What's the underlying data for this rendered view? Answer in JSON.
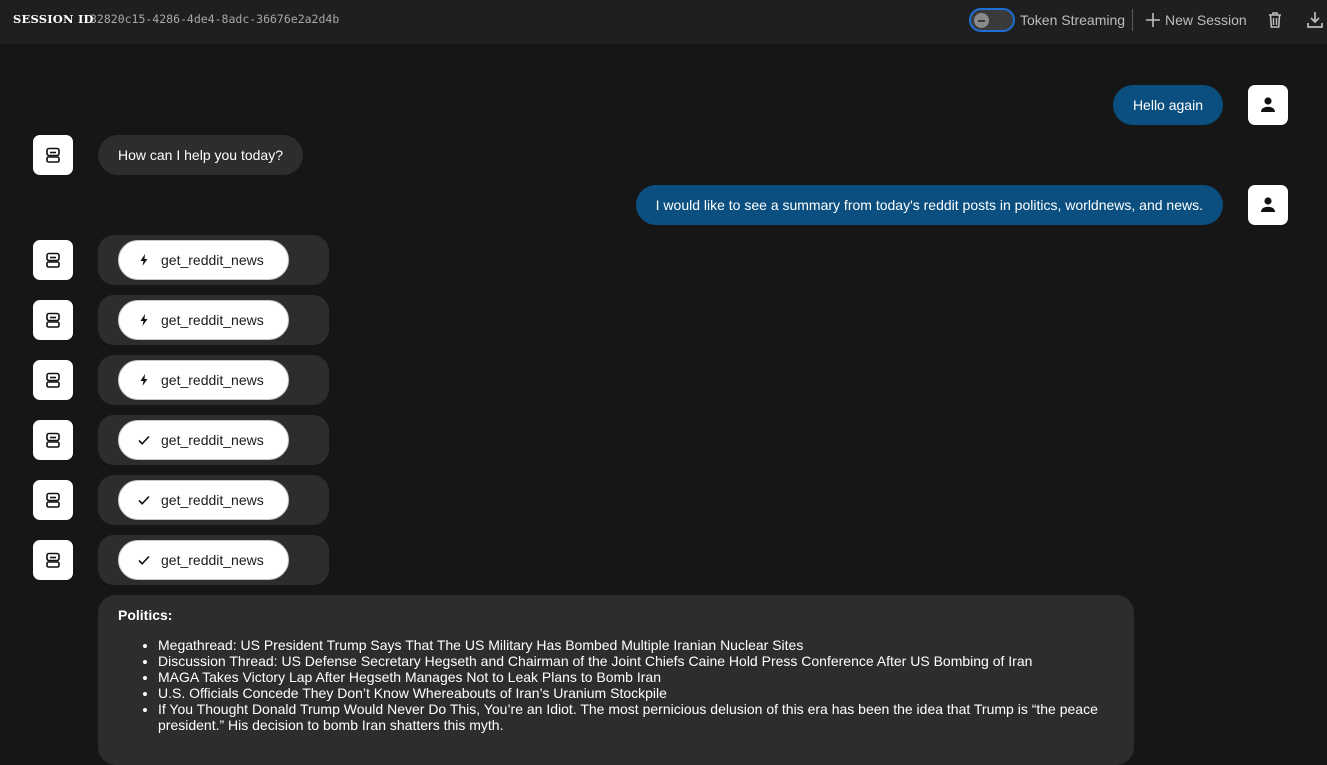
{
  "header": {
    "session_label": "SESSION ID",
    "session_id": "32820c15-4286-4de4-8adc-36676e2a2d4b",
    "token_streaming_label": "Token Streaming",
    "token_streaming_on": false,
    "new_session_label": "New Session",
    "accent_color": "#1f6fd6"
  },
  "messages": [
    {
      "role": "user",
      "text": "Hello again",
      "avatar_icon": "person-icon"
    },
    {
      "role": "assistant",
      "text": "How can I help you today?",
      "avatar_icon": "robot-icon"
    },
    {
      "role": "user",
      "text": "I would like to see a summary from today's reddit posts in politics, worldnews, and news.",
      "avatar_icon": "person-icon"
    }
  ],
  "tool_calls": [
    {
      "name": "get_reddit_news",
      "status": "running",
      "icon": "lightning-icon"
    },
    {
      "name": "get_reddit_news",
      "status": "running",
      "icon": "lightning-icon"
    },
    {
      "name": "get_reddit_news",
      "status": "running",
      "icon": "lightning-icon"
    },
    {
      "name": "get_reddit_news",
      "status": "done",
      "icon": "check-icon"
    },
    {
      "name": "get_reddit_news",
      "status": "done",
      "icon": "check-icon"
    },
    {
      "name": "get_reddit_news",
      "status": "done",
      "icon": "check-icon"
    }
  ],
  "summary": {
    "heading": "Politics:",
    "items": [
      "Megathread: US President Trump Says That The US Military Has Bombed Multiple Iranian Nuclear Sites",
      "Discussion Thread: US Defense Secretary Hegseth and Chairman of the Joint Chiefs Caine Hold Press Conference After US Bombing of Iran",
      "MAGA Takes Victory Lap After Hegseth Manages Not to Leak Plans to Bomb Iran",
      "U.S. Officials Concede They Don’t Know Whereabouts of Iran’s Uranium Stockpile",
      "If You Thought Donald Trump Would Never Do This, You’re an Idiot. The most pernicious delusion of this era has been the idea that Trump is “the peace president.” His decision to bomb Iran shatters this myth."
    ]
  },
  "colors": {
    "background": "#161616",
    "header_bg": "#1f1f1f",
    "user_bubble": "#0a4f80",
    "assistant_bubble": "#2d2d2d"
  }
}
